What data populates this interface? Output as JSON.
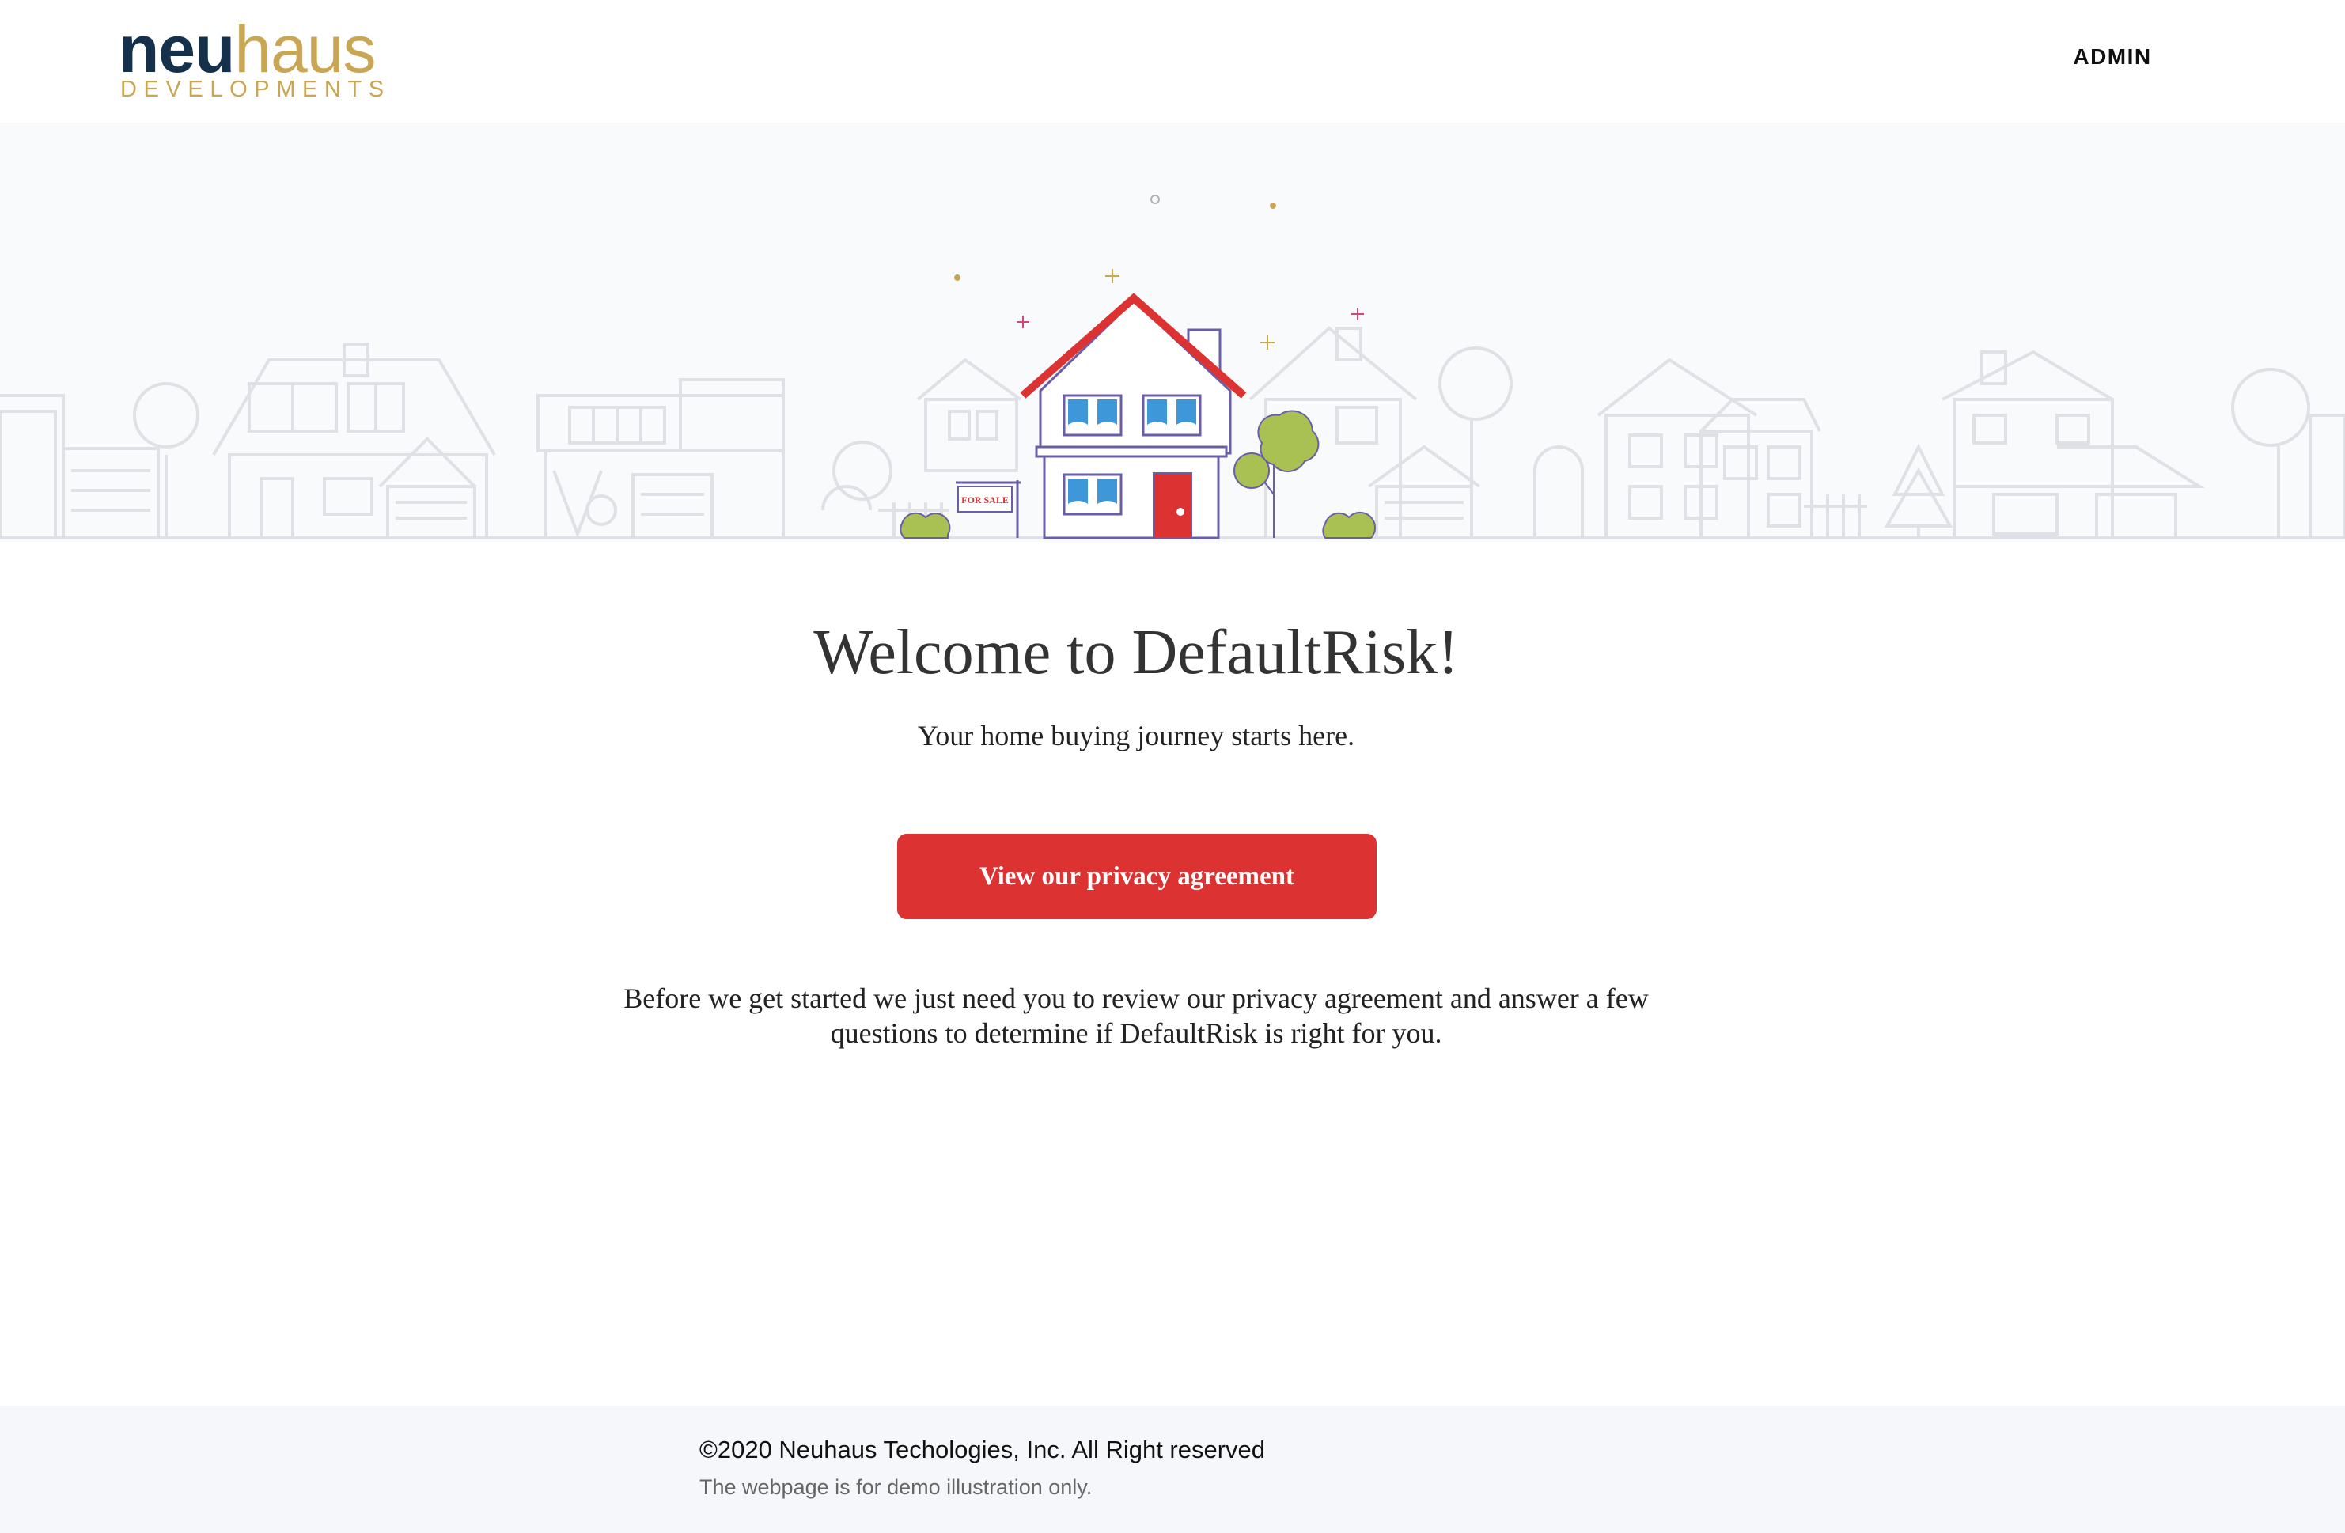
{
  "header": {
    "logo": {
      "part1": "neu",
      "part2": "haus",
      "tagline": "DEVELOPMENTS"
    },
    "nav": {
      "admin_label": "ADMIN"
    }
  },
  "hero": {
    "sign_text": "FOR SALE"
  },
  "main": {
    "title": "Welcome to DefaultRisk!",
    "subtitle": "Your home buying journey starts here.",
    "cta_label": "View our privacy agreement",
    "body_text": "Before we get started we just need you to review our privacy agreement and answer a few questions to determine if DefaultRisk is right for you."
  },
  "footer": {
    "copyright": "©2020 Neuhaus Techologies, Inc. All Right reserved",
    "note": "The webpage is for demo illustration only."
  },
  "colors": {
    "brand_navy": "#14304a",
    "brand_gold": "#c9a654",
    "accent_red": "#dc3232",
    "hero_bg": "#f9fafb",
    "footer_bg": "#f6f7fa"
  }
}
